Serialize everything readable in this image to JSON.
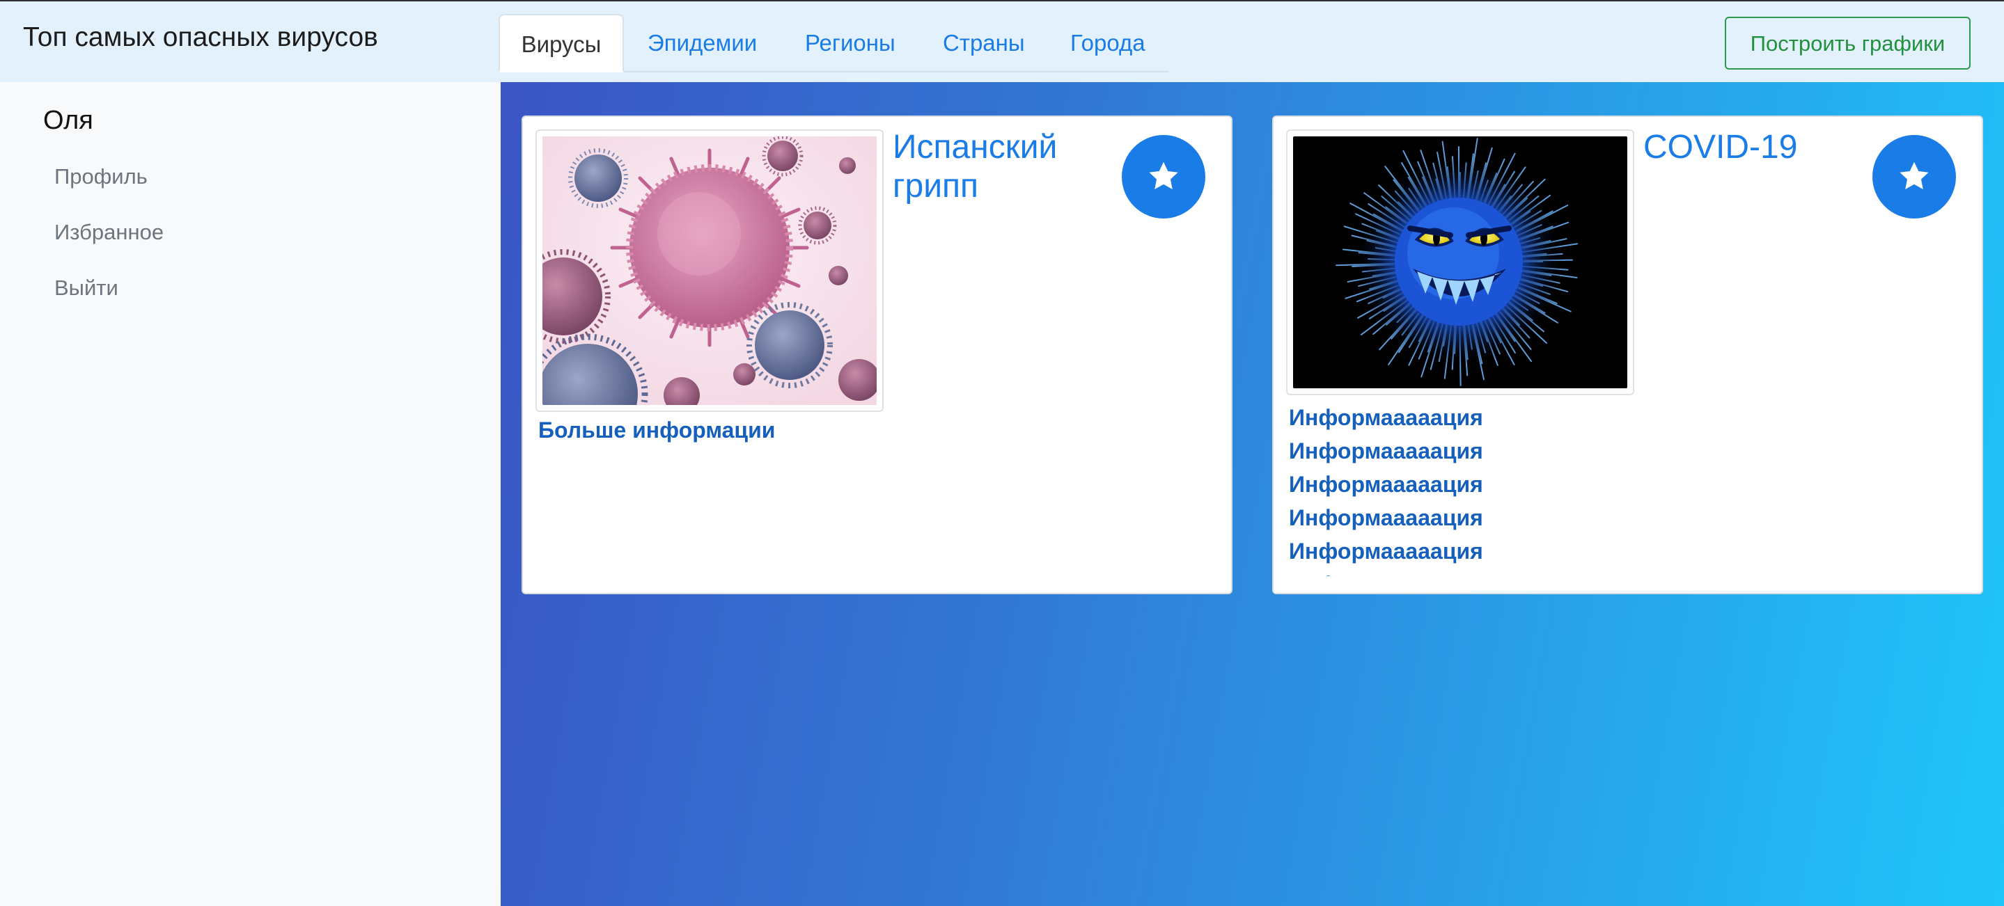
{
  "header": {
    "title": "Топ самых опасных вирусов",
    "tabs": [
      {
        "label": "Вирусы",
        "active": true
      },
      {
        "label": "Эпидемии"
      },
      {
        "label": "Регионы"
      },
      {
        "label": "Страны"
      },
      {
        "label": "Города"
      }
    ],
    "build_button": "Построить графики"
  },
  "sidebar": {
    "user": "Оля",
    "links": [
      "Профиль",
      "Избранное",
      "Выйти"
    ]
  },
  "cards": [
    {
      "title": "Испанский грипп",
      "link": "Больше информации",
      "image": "pink-virus-microscope-image",
      "favorite_icon": "star-icon"
    },
    {
      "title": "COVID-19",
      "image": "blue-monster-virus-image",
      "favorite_icon": "star-icon",
      "info_links": [
        "Информааааация",
        "Информааааация",
        "Информааааация",
        "Информааааация",
        "Информааааация",
        "Информааааация"
      ]
    }
  ],
  "colors": {
    "accent": "#1a7ce6",
    "link": "#1560bd",
    "success": "#21913f",
    "header_bg": "#e3f1fc",
    "sidebar_bg": "#f7f9fb"
  }
}
